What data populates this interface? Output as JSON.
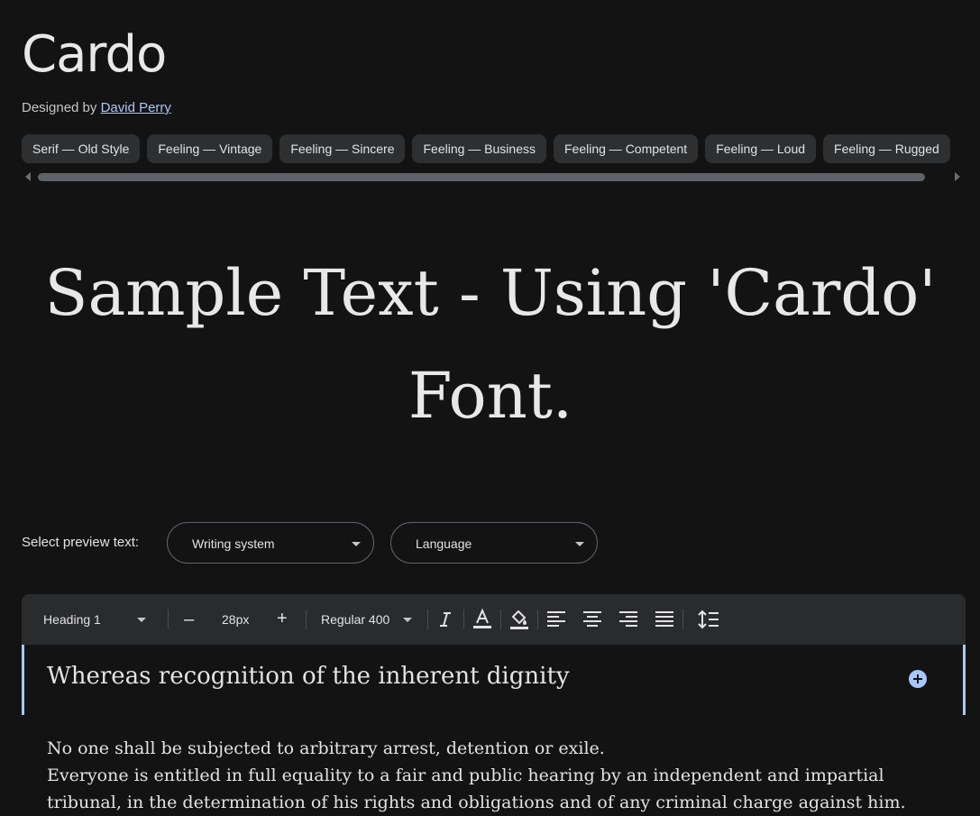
{
  "font": {
    "name": "Cardo",
    "designed_by_label": "Designed by",
    "designer": "David Perry"
  },
  "tags": [
    "Serif — Old Style",
    "Feeling — Vintage",
    "Feeling — Sincere",
    "Feeling — Business",
    "Feeling — Competent",
    "Feeling — Loud",
    "Feeling — Rugged"
  ],
  "sample_text": "Sample Text - Using 'Cardo' Font.",
  "preview": {
    "label": "Select preview text:",
    "writing_system": "Writing system",
    "language": "Language"
  },
  "toolbar": {
    "style": "Heading 1",
    "decrease": "–",
    "size": "28px",
    "increase": "+",
    "weight": "Regular 400"
  },
  "editor": {
    "heading": "Whereas recognition of the inherent dignity",
    "paragraph_lines": [
      "No one shall be subjected to arbitrary arrest, detention or exile.",
      "Everyone is entitled in full equality to a fair and public hearing by an independent and impartial",
      "tribunal, in the determination of his rights and obligations and of any criminal charge against him."
    ]
  },
  "colors": {
    "background": "#131313",
    "accent": "#a8c7fa",
    "chip_bg": "#2d2f31",
    "toolbar_bg": "#2a2b2d"
  }
}
